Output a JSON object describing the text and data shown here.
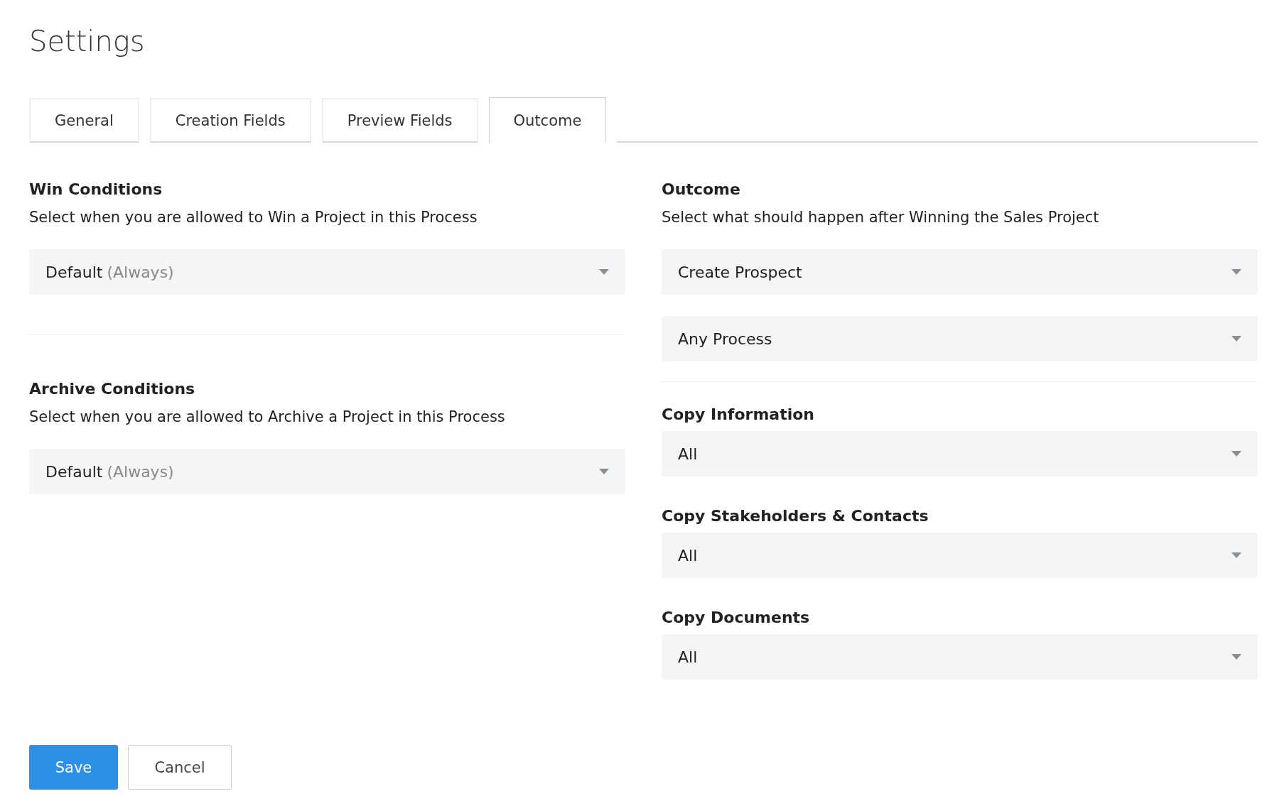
{
  "page": {
    "title": "Settings"
  },
  "tabs": [
    {
      "label": "General",
      "selected": false
    },
    {
      "label": "Creation Fields",
      "selected": false
    },
    {
      "label": "Preview Fields",
      "selected": false
    },
    {
      "label": "Outcome",
      "selected": true
    }
  ],
  "conditions": [
    {
      "title": "Win Conditions",
      "description": "Select when you are allowed to Win a Project in this Process",
      "select": {
        "value": "Default",
        "hint": "(Always)"
      }
    },
    {
      "title": "Archive Conditions",
      "description": "Select when you are allowed to Archive a Project in this Process",
      "select": {
        "value": "Default",
        "hint": "(Always)"
      }
    }
  ],
  "outcome": {
    "title": "Outcome",
    "description": "Select what should happen after Winning the Sales Project",
    "selects": [
      {
        "value": "Create Prospect"
      },
      {
        "value": "Any Process"
      }
    ]
  },
  "copy_fields": [
    {
      "label": "Copy Information",
      "select": {
        "value": "All"
      }
    },
    {
      "label": "Copy Stakeholders & Contacts",
      "select": {
        "value": "All"
      }
    },
    {
      "label": "Copy Documents",
      "select": {
        "value": "All"
      }
    }
  ],
  "buttons": [
    {
      "label": "Save",
      "kind": "primary"
    },
    {
      "label": "Cancel",
      "kind": "secondary"
    }
  ]
}
